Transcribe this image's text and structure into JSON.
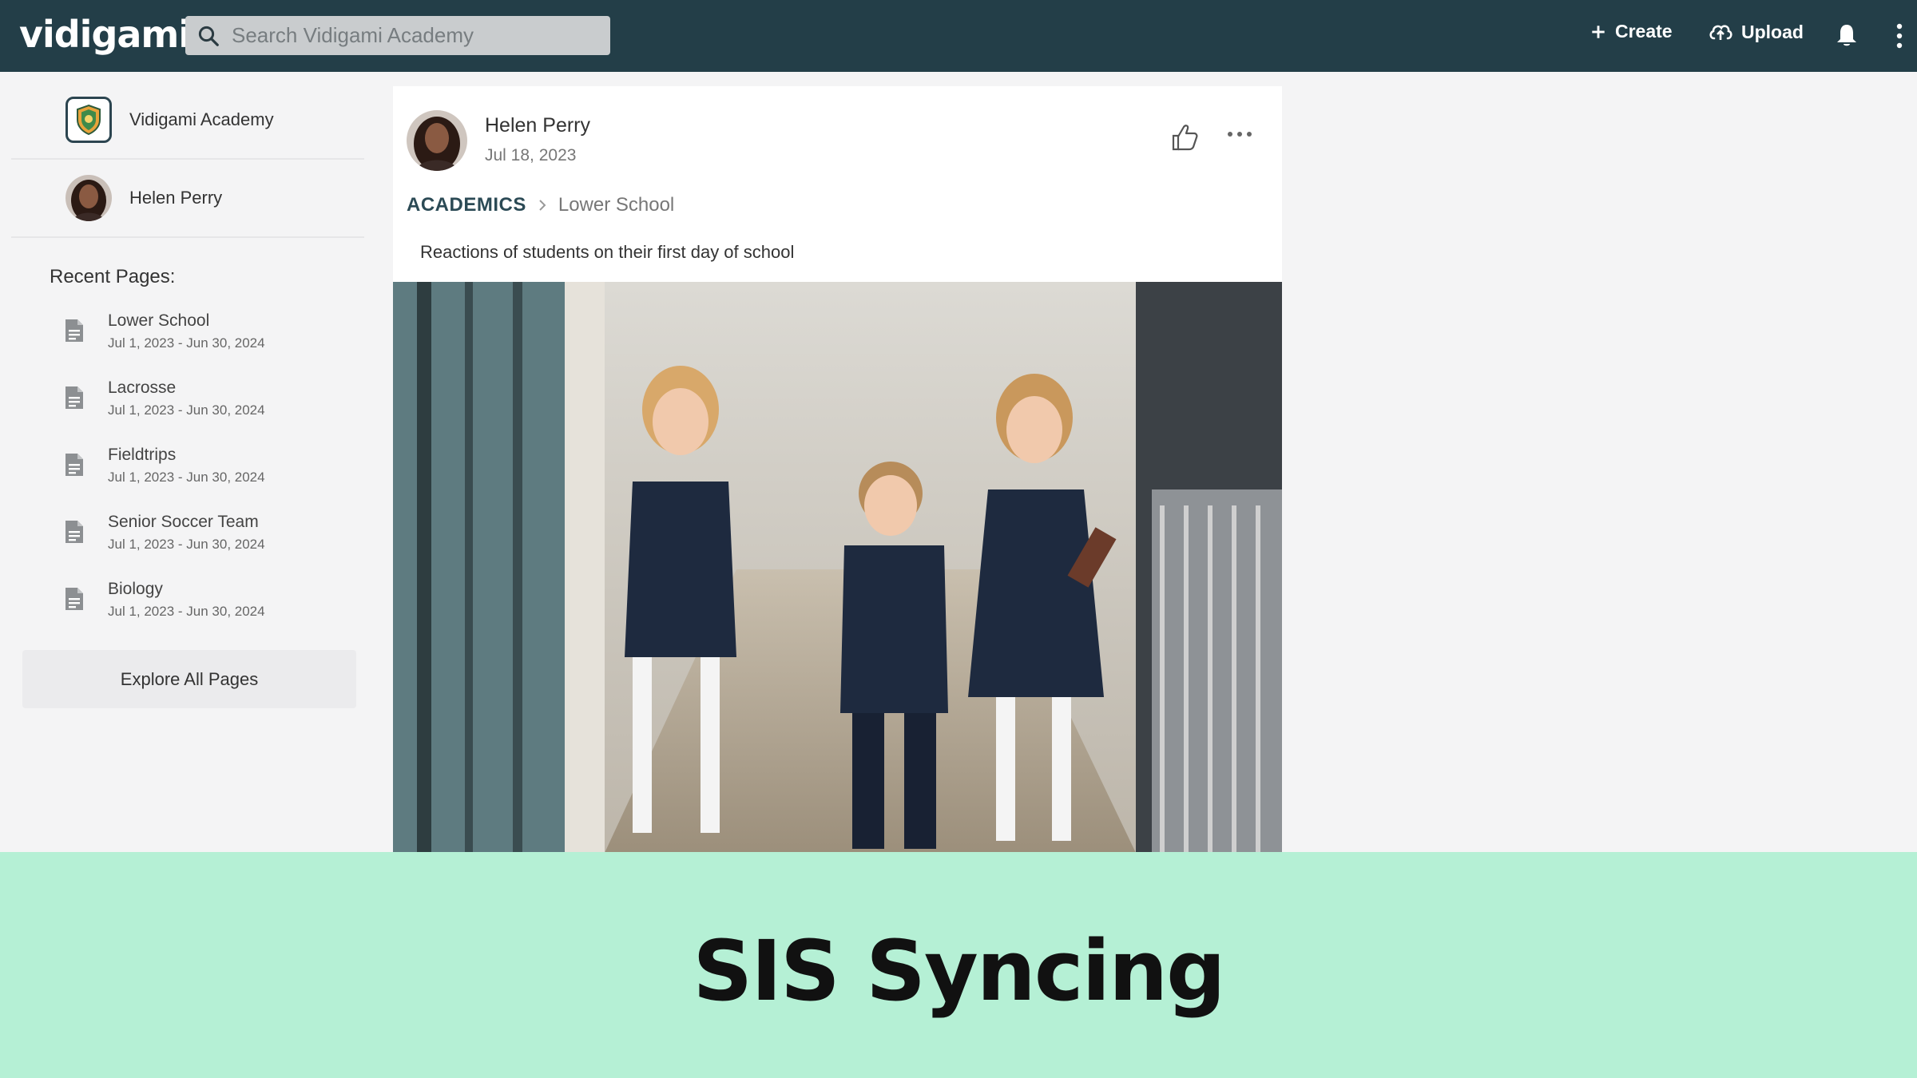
{
  "header": {
    "logo_text": "vidigami",
    "search_placeholder": "Search Vidigami Academy",
    "create_label": "Create",
    "upload_label": "Upload"
  },
  "sidebar": {
    "academy_name": "Vidigami Academy",
    "user_name": "Helen Perry",
    "recent_title": "Recent Pages:",
    "recent_pages": [
      {
        "title": "Lower School",
        "date": "Jul 1, 2023 - Jun 30, 2024"
      },
      {
        "title": "Lacrosse",
        "date": "Jul 1, 2023 - Jun 30, 2024"
      },
      {
        "title": "Fieldtrips",
        "date": "Jul 1, 2023 - Jun 30, 2024"
      },
      {
        "title": "Senior Soccer Team",
        "date": "Jul 1, 2023 - Jun 30, 2024"
      },
      {
        "title": "Biology",
        "date": "Jul 1, 2023 - Jun 30, 2024"
      }
    ],
    "explore_label": "Explore All Pages"
  },
  "post": {
    "author": "Helen Perry",
    "date": "Jul 18, 2023",
    "breadcrumb": [
      "ACADEMICS",
      "Lower School"
    ],
    "caption": "Reactions of students on their first day of school"
  },
  "banner": {
    "title": "SIS Syncing"
  },
  "colors": {
    "topbar": "#233e48",
    "banner": "#b5f0d5",
    "accent": "#2b4a55"
  }
}
